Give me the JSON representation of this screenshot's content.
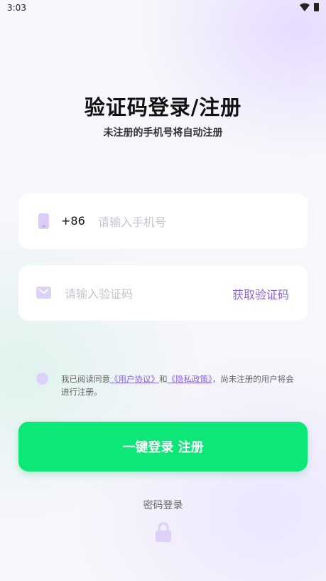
{
  "status": {
    "time": "3:03",
    "wifi_icon": "wifi-icon",
    "battery_icon": "battery-icon"
  },
  "header": {
    "title": "验证码登录/注册",
    "subtitle": "未注册的手机号将自动注册"
  },
  "phone": {
    "icon": "phone-icon",
    "country_code": "+86",
    "placeholder": "请输入手机号",
    "value": ""
  },
  "code": {
    "icon": "mail-icon",
    "placeholder": "请输入验证码",
    "value": "",
    "get_code_label": "获取验证码"
  },
  "agreement": {
    "checked": false,
    "prefix": "我已阅读同意",
    "user_agreement": "《用户协议》",
    "and": "和",
    "privacy_policy": "《隐私政策》",
    "suffix": "，尚未注册的用户将会进行注册。"
  },
  "login_button": {
    "label": "一键登录 注册"
  },
  "password_login": {
    "label": "密码登录",
    "icon": "lock-icon"
  },
  "colors": {
    "accent": "#8b63e0",
    "primary_button": "#0ce777",
    "icon_tint": "#ddd0f9"
  }
}
